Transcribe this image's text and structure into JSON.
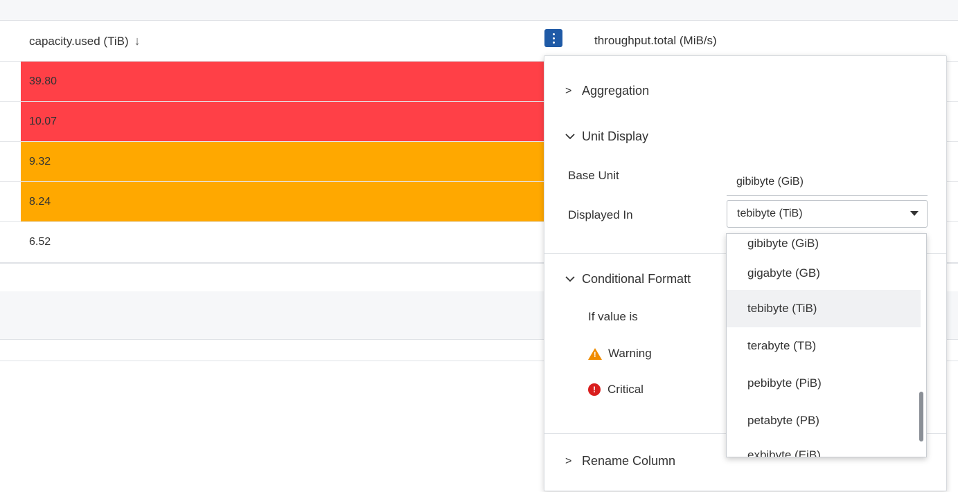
{
  "table": {
    "columns": [
      {
        "title": "capacity.used (TiB)",
        "sort_icon": "arrow-down-icon",
        "sort_glyph": "↓"
      },
      {
        "title": "throughput.total (MiB/s)"
      }
    ],
    "rows": [
      {
        "value": "39.80",
        "status": "critical"
      },
      {
        "value": "10.07",
        "status": "critical"
      },
      {
        "value": "9.32",
        "status": "warning"
      },
      {
        "value": "8.24",
        "status": "warning"
      },
      {
        "value": "6.52",
        "status": "normal"
      }
    ],
    "status_colors": {
      "critical": "#ff4047",
      "warning": "#ffa800",
      "accent": "#1f5aa6"
    }
  },
  "column_menu": {
    "aggregation": {
      "title": "Aggregation",
      "expanded": false
    },
    "unit_display": {
      "title": "Unit Display",
      "expanded": true,
      "base_unit_label": "Base Unit",
      "base_unit_value": "gibibyte (GiB)",
      "displayed_in_label": "Displayed In",
      "displayed_in_value": "tebibyte (TiB)",
      "options": [
        "gibibyte (GiB)",
        "gigabyte (GB)",
        "tebibyte (TiB)",
        "terabyte (TB)",
        "pebibyte (PiB)",
        "petabyte (PB)",
        "exbibyte (EiB)"
      ],
      "selected_option": "tebibyte (TiB)"
    },
    "conditional_formatting": {
      "title": "Conditional Formatt",
      "expanded": true,
      "if_value_label": "If value is",
      "warning_label": "Warning",
      "critical_label": "Critical"
    },
    "rename_column": {
      "title": "Rename Column",
      "expanded": false
    }
  }
}
